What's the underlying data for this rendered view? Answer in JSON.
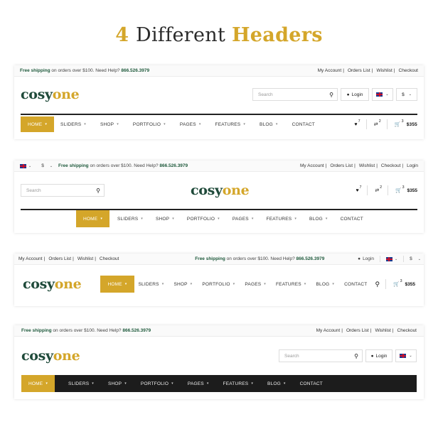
{
  "heading": {
    "part1": "4 ",
    "part2": "Different ",
    "part3": "Headers"
  },
  "shipping": {
    "bold": "Free shipping",
    "rest": " on orders over $100. Need Help? ",
    "phone": "866.526.3979"
  },
  "account_links": [
    "My Account",
    "Orders List",
    "Wishlist",
    "Checkout"
  ],
  "account_links_login": [
    "My Account",
    "Orders List",
    "Wishlist",
    "Checkout",
    "Login"
  ],
  "logo": {
    "a": "cosy",
    "b": "one"
  },
  "search_placeholder": "Search",
  "login_label": "Login",
  "currency": "$",
  "cart_total": "$355",
  "counts": {
    "wishlist": "7",
    "compare": "2",
    "cart": "3"
  },
  "nav": [
    "HOME",
    "SLIDERS",
    "SHOP",
    "PORTFOLIO",
    "PAGES",
    "FEATURES",
    "BLOG",
    "CONTACT"
  ],
  "colors": {
    "gold": "#d4a62a",
    "green": "#1f4a3a",
    "dark_nav": "#1c1c1c"
  }
}
